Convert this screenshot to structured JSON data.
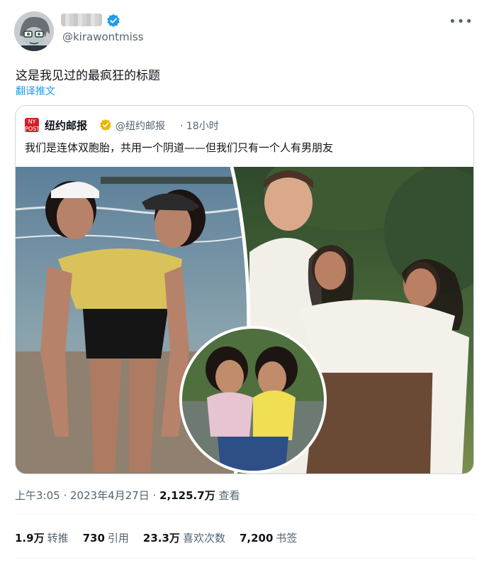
{
  "author": {
    "handle": "@kirawontmiss",
    "verified_color": "#1d9bf0"
  },
  "tweet": {
    "text": "这是我见过的最疯狂的标题",
    "translate_label": "翻译推文"
  },
  "quoted": {
    "name": "纽约邮报",
    "handle": "@纽约邮报",
    "time": "· 18小时",
    "text": "我们是连体双胞胎，共用一个阴道——但我们只有一个人有男朋友",
    "brand_color": "#d3202a",
    "badge_color": "#e8b500"
  },
  "meta": {
    "datetime": "上午3:05 · 2023年4月27日 · ",
    "views_count": "2,125.7万",
    "views_label": " 查看"
  },
  "stats": [
    {
      "count": "1.9万",
      "label": "转推"
    },
    {
      "count": "730",
      "label": "引用"
    },
    {
      "count": "23.3万",
      "label": "喜欢次数"
    },
    {
      "count": "7,200",
      "label": "书签"
    }
  ],
  "icons": {
    "more": "more-options-icon",
    "verified": "verified-badge-icon",
    "gold_badge": "gold-check-badge-icon",
    "brand_logo": "nypost-logo-icon"
  }
}
